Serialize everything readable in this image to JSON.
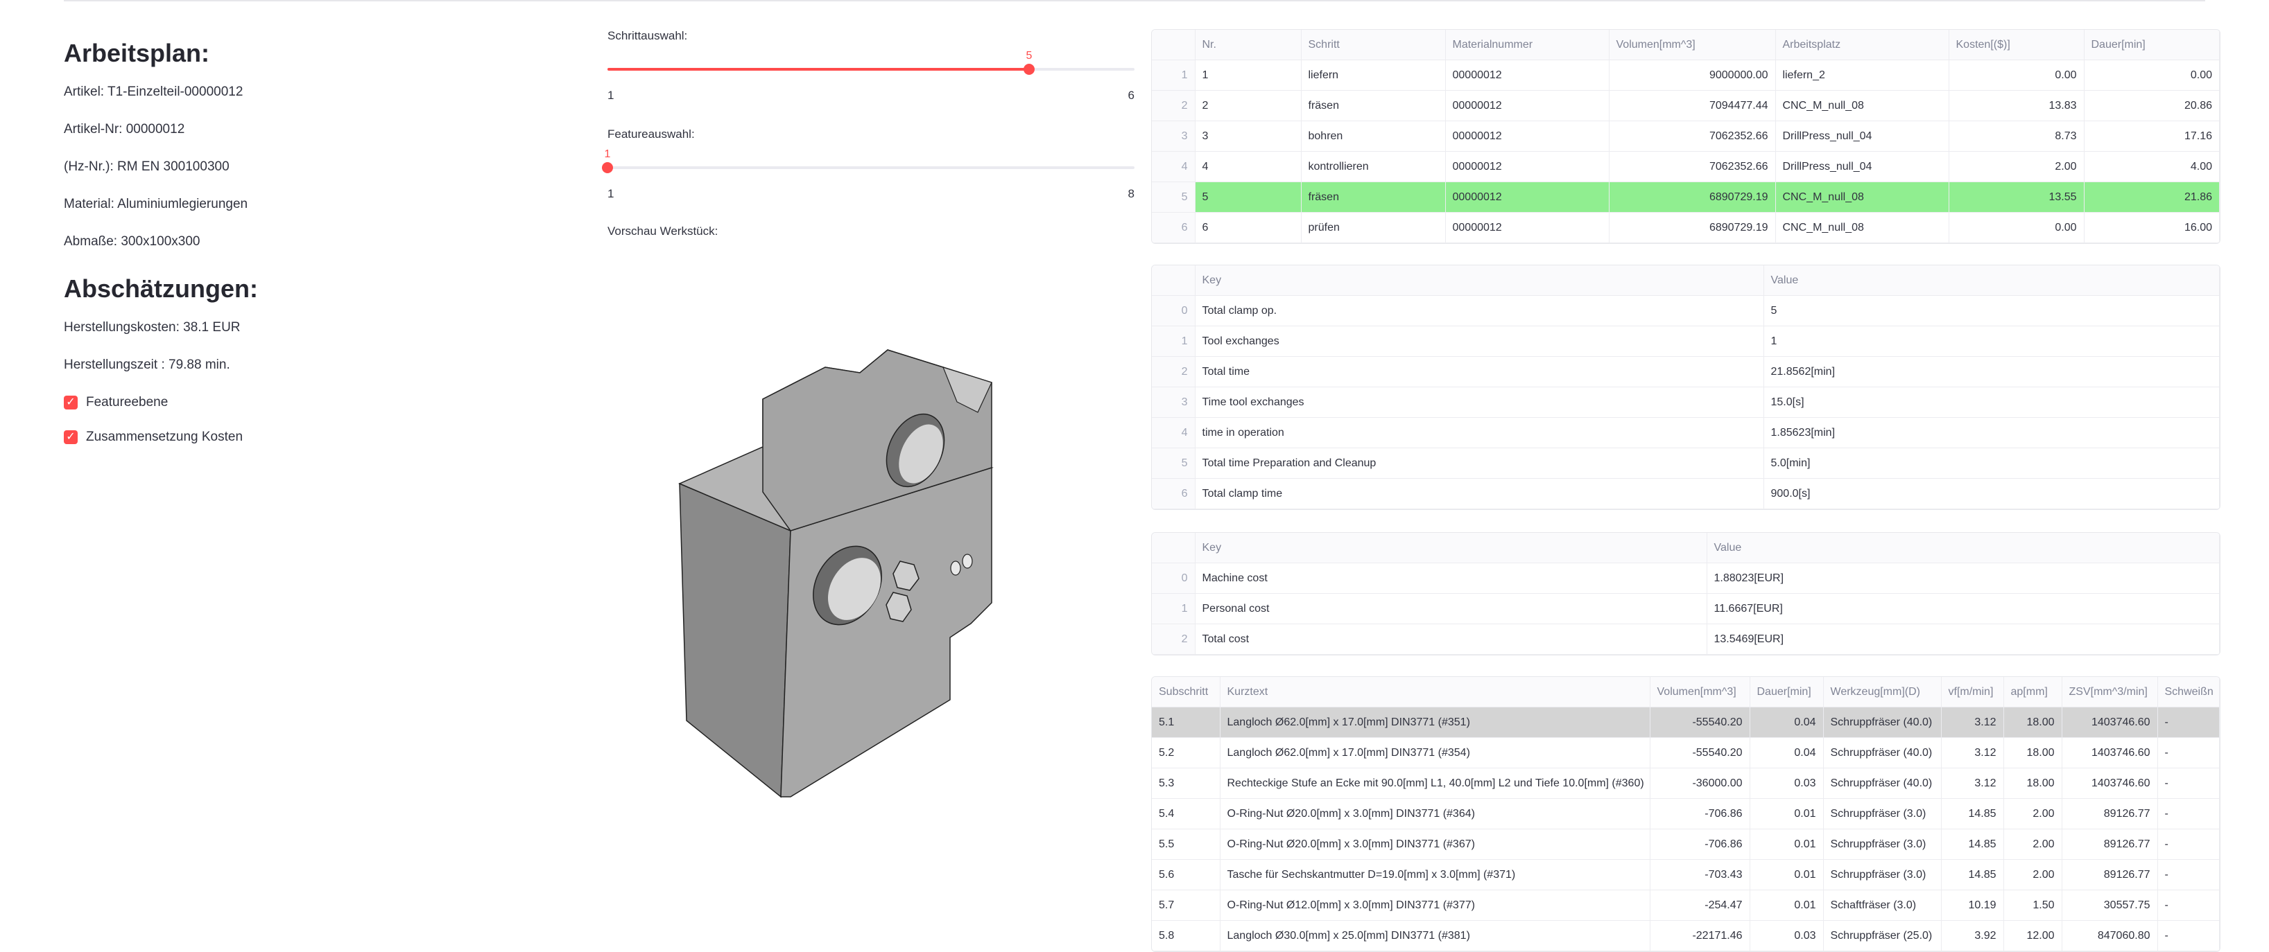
{
  "left": {
    "plan_title": "Arbeitsplan:",
    "artikel": "Artikel: T1-Einzelteil-00000012",
    "artikel_nr": "Artikel-Nr: 00000012",
    "hz_nr": "(Hz-Nr.): RM EN 300100300",
    "material": "Material: Aluminiumlegierungen",
    "abmasse": "Abmaße: 300x100x300",
    "estimate_title": "Abschätzungen:",
    "kosten": "Herstellungskosten: 38.1 EUR",
    "zeit": "Herstellungszeit : 79.88 min.",
    "check1": "Featureebene",
    "check2": "Zusammensetzung Kosten"
  },
  "middle": {
    "step_label": "Schrittauswahl:",
    "step_value": "5",
    "step_value_num": 5,
    "step_min": "1",
    "step_max": "6",
    "feature_label": "Featureauswahl:",
    "feature_value": "1",
    "feature_value_num": 1,
    "feature_min": "1",
    "feature_max": "8",
    "preview_label": "Vorschau Werkstück:"
  },
  "steps_table": {
    "headers": [
      "",
      "Nr.",
      "Schritt",
      "Materialnummer",
      "Volumen[mm^3]",
      "Arbeitsplatz",
      "Kosten[($)]",
      "Dauer[min]"
    ],
    "rows": [
      [
        "1",
        "1",
        "liefern",
        "00000012",
        "9000000.00",
        "liefern_2",
        "0.00",
        "0.00"
      ],
      [
        "2",
        "2",
        "fräsen",
        "00000012",
        "7094477.44",
        "CNC_M_null_08",
        "13.83",
        "20.86"
      ],
      [
        "3",
        "3",
        "bohren",
        "00000012",
        "7062352.66",
        "DrillPress_null_04",
        "8.73",
        "17.16"
      ],
      [
        "4",
        "4",
        "kontrollieren",
        "00000012",
        "7062352.66",
        "DrillPress_null_04",
        "2.00",
        "4.00"
      ],
      [
        "5",
        "5",
        "fräsen",
        "00000012",
        "6890729.19",
        "CNC_M_null_08",
        "13.55",
        "21.86"
      ],
      [
        "6",
        "6",
        "prüfen",
        "00000012",
        "6890729.19",
        "CNC_M_null_08",
        "0.00",
        "16.00"
      ]
    ]
  },
  "time_table": {
    "headers": [
      "",
      "Key",
      "Value"
    ],
    "rows": [
      [
        "0",
        "Total clamp op.",
        "5"
      ],
      [
        "1",
        "Tool exchanges",
        "1"
      ],
      [
        "2",
        "Total time",
        "21.8562[min]"
      ],
      [
        "3",
        "Time tool exchanges",
        "15.0[s]"
      ],
      [
        "4",
        "time in operation",
        "1.85623[min]"
      ],
      [
        "5",
        "Total time Preparation and Cleanup",
        "5.0[min]"
      ],
      [
        "6",
        "Total clamp time",
        "900.0[s]"
      ]
    ]
  },
  "cost_table": {
    "headers": [
      "",
      "Key",
      "Value"
    ],
    "rows": [
      [
        "0",
        "Machine cost",
        "1.88023[EUR]"
      ],
      [
        "1",
        "Personal cost",
        "11.6667[EUR]"
      ],
      [
        "2",
        "Total cost",
        "13.5469[EUR]"
      ]
    ]
  },
  "sub_table": {
    "headers": [
      "Subschritt",
      "Kurztext",
      "Volumen[mm^3]",
      "Dauer[min]",
      "Werkzeug[mm](D)",
      "vf[m/min]",
      "ap[mm]",
      "ZSV[mm^3/min]",
      "Schweißn"
    ],
    "rows": [
      [
        "5.1",
        "Langloch Ø62.0[mm] x 17.0[mm] DIN3771 (#351)",
        "-55540.20",
        "0.04",
        "Schruppfräser (40.0)",
        "3.12",
        "18.00",
        "1403746.60",
        "-"
      ],
      [
        "5.2",
        "Langloch Ø62.0[mm] x 17.0[mm] DIN3771 (#354)",
        "-55540.20",
        "0.04",
        "Schruppfräser (40.0)",
        "3.12",
        "18.00",
        "1403746.60",
        "-"
      ],
      [
        "5.3",
        "Rechteckige Stufe an Ecke mit 90.0[mm] L1, 40.0[mm] L2 und Tiefe 10.0[mm] (#360)",
        "-36000.00",
        "0.03",
        "Schruppfräser (40.0)",
        "3.12",
        "18.00",
        "1403746.60",
        "-"
      ],
      [
        "5.4",
        "O-Ring-Nut Ø20.0[mm] x 3.0[mm] DIN3771 (#364)",
        "-706.86",
        "0.01",
        "Schruppfräser (3.0)",
        "14.85",
        "2.00",
        "89126.77",
        "-"
      ],
      [
        "5.5",
        "O-Ring-Nut Ø20.0[mm] x 3.0[mm] DIN3771 (#367)",
        "-706.86",
        "0.01",
        "Schruppfräser (3.0)",
        "14.85",
        "2.00",
        "89126.77",
        "-"
      ],
      [
        "5.6",
        "Tasche für Sechskantmutter D=19.0[mm] x 3.0[mm] (#371)",
        "-703.43",
        "0.01",
        "Schruppfräser (3.0)",
        "14.85",
        "2.00",
        "89126.77",
        "-"
      ],
      [
        "5.7",
        "O-Ring-Nut Ø12.0[mm] x 3.0[mm] DIN3771 (#377)",
        "-254.47",
        "0.01",
        "Schaftfräser (3.0)",
        "10.19",
        "1.50",
        "30557.75",
        "-"
      ],
      [
        "5.8",
        "Langloch Ø30.0[mm] x 25.0[mm] DIN3771 (#381)",
        "-22171.46",
        "0.03",
        "Schruppfräser (25.0)",
        "3.92",
        "12.00",
        "847060.80",
        "-"
      ]
    ]
  },
  "colors": {
    "accent": "#ff4b4b",
    "highlight_row": "#90ee90",
    "selected_row": "#d4d4d4",
    "part": "#a0a0a0"
  }
}
